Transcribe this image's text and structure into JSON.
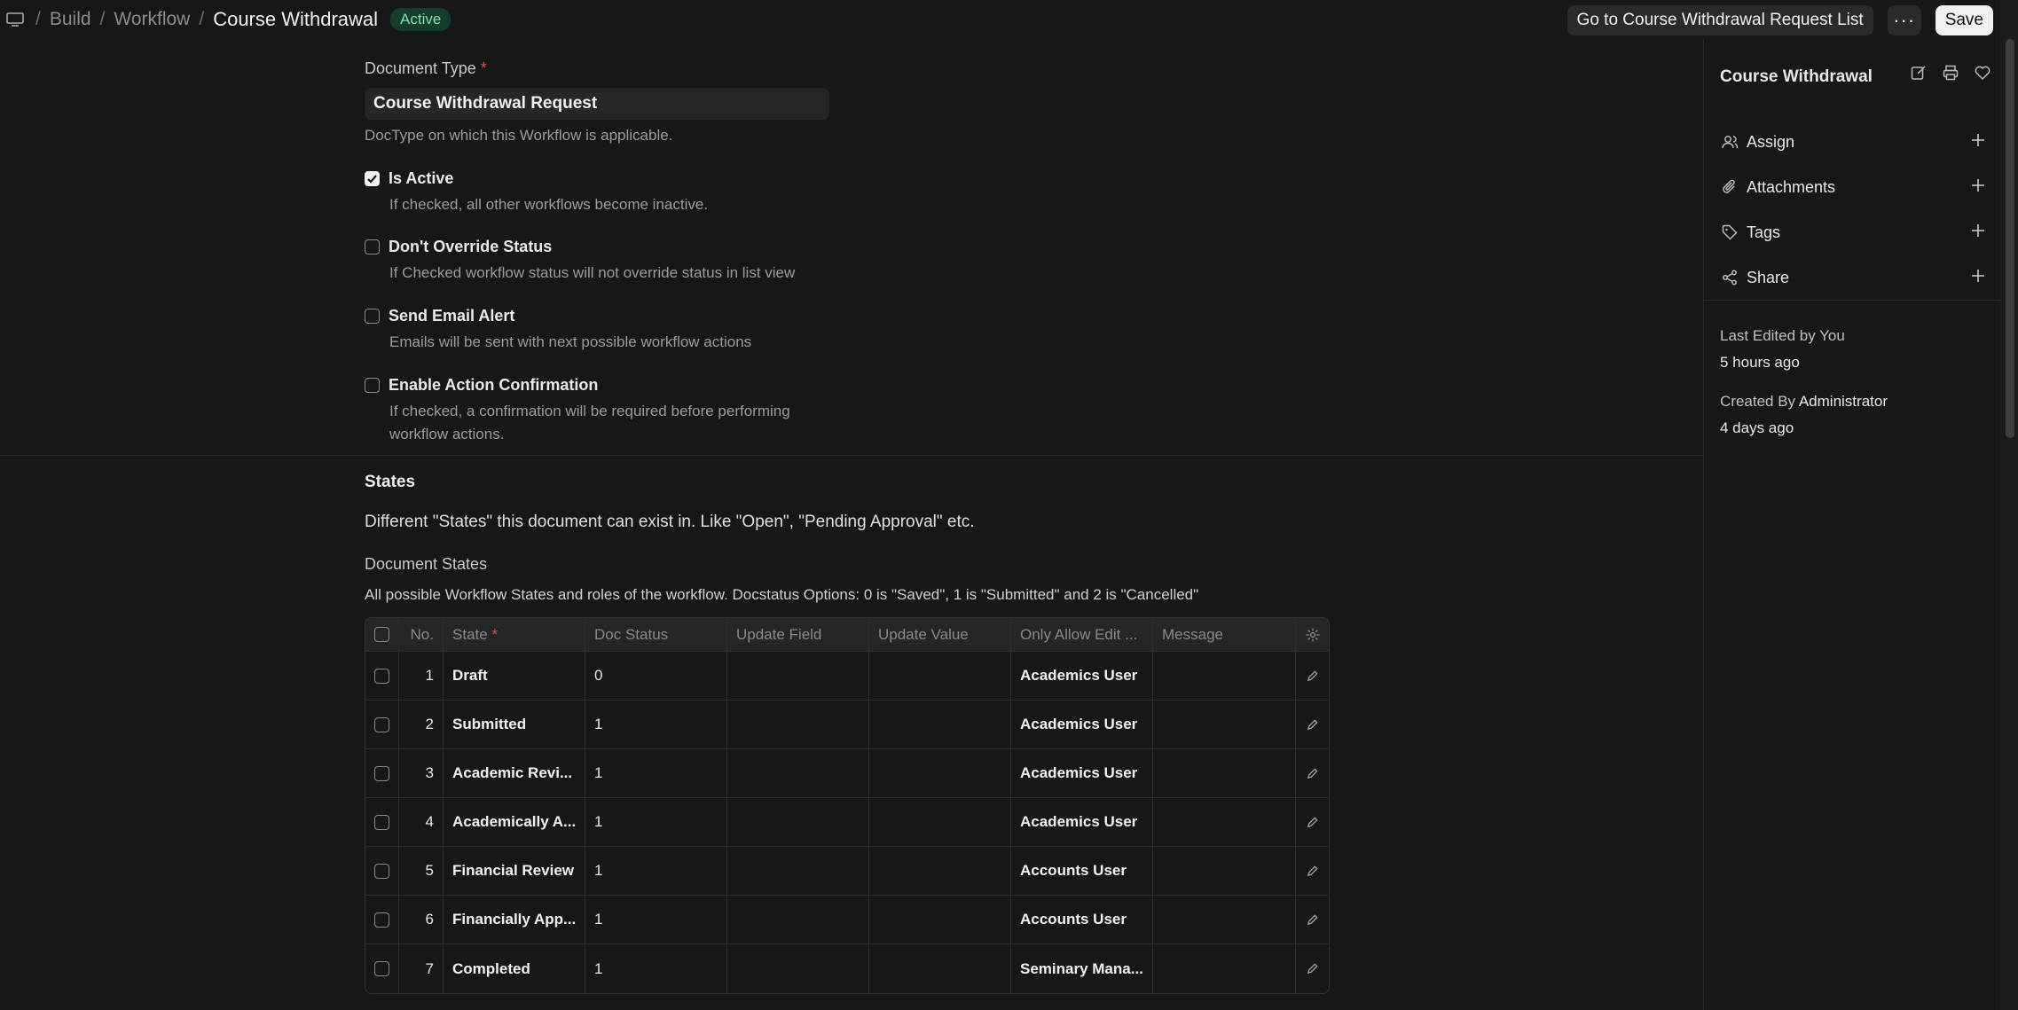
{
  "breadcrumb": {
    "items": [
      "Build",
      "Workflow"
    ],
    "current": "Course Withdrawal",
    "status_badge": "Active"
  },
  "toolbar": {
    "go_to_list": "Go to Course Withdrawal Request List",
    "more": "···",
    "save": "Save"
  },
  "form": {
    "document_type": {
      "label": "Document Type",
      "required_mark": "*",
      "value": "Course Withdrawal Request",
      "description": "DocType on which this Workflow is applicable."
    },
    "is_active": {
      "label": "Is Active",
      "checked": true,
      "description": "If checked, all other workflows become inactive."
    },
    "dont_override_status": {
      "label": "Don't Override Status",
      "checked": false,
      "description": "If Checked workflow status will not override status in list view"
    },
    "send_email_alert": {
      "label": "Send Email Alert",
      "checked": false,
      "description": "Emails will be sent with next possible workflow actions"
    },
    "enable_action_confirmation": {
      "label": "Enable Action Confirmation",
      "checked": false,
      "description_line1": "If checked, a confirmation will be required before performing",
      "description_line2": "workflow actions."
    }
  },
  "states_section": {
    "title": "States",
    "intro": "Different \"States\" this document can exist in. Like \"Open\", \"Pending Approval\" etc.",
    "table_label": "Document States",
    "table_description": "All possible Workflow States and roles of the workflow. Docstatus Options: 0 is \"Saved\", 1 is \"Submitted\" and 2 is \"Cancelled\""
  },
  "table": {
    "headers": {
      "no": "No.",
      "state": "State",
      "state_required": "*",
      "doc_status": "Doc Status",
      "update_field": "Update Field",
      "update_value": "Update Value",
      "only_allow_edit": "Only Allow Edit ...",
      "message": "Message"
    },
    "rows": [
      {
        "no": "1",
        "state": "Draft",
        "doc_status": "0",
        "update_field": "",
        "update_value": "",
        "only_allow_edit": "Academics User",
        "message": ""
      },
      {
        "no": "2",
        "state": "Submitted",
        "doc_status": "1",
        "update_field": "",
        "update_value": "",
        "only_allow_edit": "Academics User",
        "message": ""
      },
      {
        "no": "3",
        "state": "Academic Revi...",
        "doc_status": "1",
        "update_field": "",
        "update_value": "",
        "only_allow_edit": "Academics User",
        "message": ""
      },
      {
        "no": "4",
        "state": "Academically A...",
        "doc_status": "1",
        "update_field": "",
        "update_value": "",
        "only_allow_edit": "Academics User",
        "message": ""
      },
      {
        "no": "5",
        "state": "Financial Review",
        "doc_status": "1",
        "update_field": "",
        "update_value": "",
        "only_allow_edit": "Accounts User",
        "message": ""
      },
      {
        "no": "6",
        "state": "Financially App...",
        "doc_status": "1",
        "update_field": "",
        "update_value": "",
        "only_allow_edit": "Accounts User",
        "message": ""
      },
      {
        "no": "7",
        "state": "Completed",
        "doc_status": "1",
        "update_field": "",
        "update_value": "",
        "only_allow_edit": "Seminary Mana...",
        "message": ""
      }
    ]
  },
  "sidebar": {
    "title": "Course Withdrawal",
    "actions": [
      {
        "label": "Assign",
        "icon": "user-icon"
      },
      {
        "label": "Attachments",
        "icon": "paperclip-icon"
      },
      {
        "label": "Tags",
        "icon": "tag-icon"
      },
      {
        "label": "Share",
        "icon": "share-icon"
      }
    ],
    "last_edited": "Last Edited by You",
    "last_edited_time": "5 hours ago",
    "created_by_prefix": "Created By",
    "created_by_user": "Administrator",
    "created_time": "4 days ago"
  },
  "colors": {
    "background": "#171717",
    "active_badge_bg": "#153d2b",
    "active_badge_text": "#7ee2a8",
    "required": "#e5484d"
  }
}
